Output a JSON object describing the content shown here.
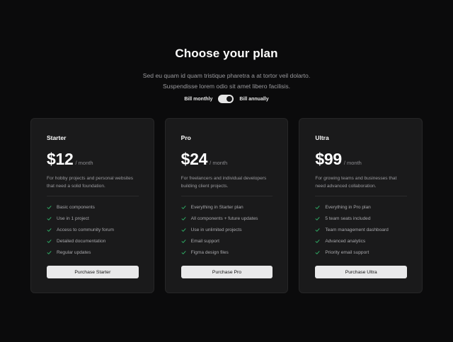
{
  "header": {
    "title": "Choose your plan",
    "subtitle_line1": "Sed eu quam id quam tristique pharetra a at tortor veil dolarto.",
    "subtitle_line2": "Suspendisse lorem odio sit amet libero facilisis."
  },
  "billing": {
    "monthly_label": "Bill monthly",
    "annually_label": "Bill annually",
    "selected": "annually"
  },
  "plans": [
    {
      "name": "Starter",
      "price": "$12",
      "period": "/ month",
      "description": "For hobby projects and personal websites that need a solid foundation.",
      "features": [
        "Basic components",
        "Use in 1 project",
        "Access to community forum",
        "Detailed documentation",
        "Regular updates"
      ],
      "button": "Purchase Starter"
    },
    {
      "name": "Pro",
      "price": "$24",
      "period": "/ month",
      "description": "For freelancers and individual developers building client projects.",
      "features": [
        "Everything in Starter plan",
        "All components + future updates",
        "Use in unlimited projects",
        "Email support",
        "Figma design files"
      ],
      "button": "Purchase Pro"
    },
    {
      "name": "Ultra",
      "price": "$99",
      "period": "/ month",
      "description": "For growing teams and businesses that need advanced collaboration.",
      "features": [
        "Everything in Pro plan",
        "5 team seats included",
        "Team management dashboard",
        "Advanced analytics",
        "Priority email support"
      ],
      "button": "Purchase Ultra"
    }
  ],
  "colors": {
    "background": "#0b0b0c",
    "card": "#1a1a1b",
    "check": "#2fae66",
    "button": "#e9e9ea"
  },
  "icons": {
    "feature": "check-icon"
  }
}
